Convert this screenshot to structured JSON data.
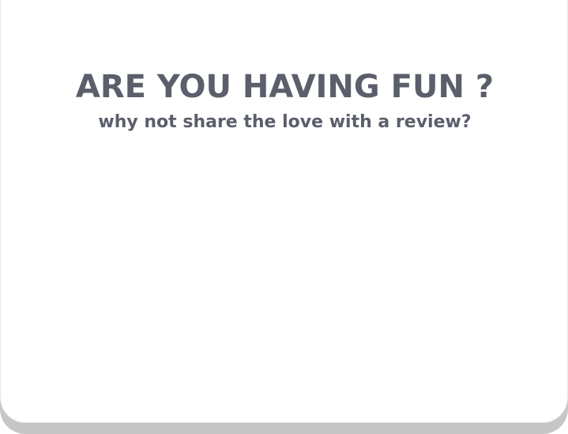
{
  "review_prompt": {
    "title": "ARE YOU HAVING FUN ?",
    "subtitle": "why not share the love with a review?"
  },
  "colors": {
    "text": "#5b5f6b",
    "card": "#ffffff",
    "card_shadow": "#c6c6c6"
  }
}
